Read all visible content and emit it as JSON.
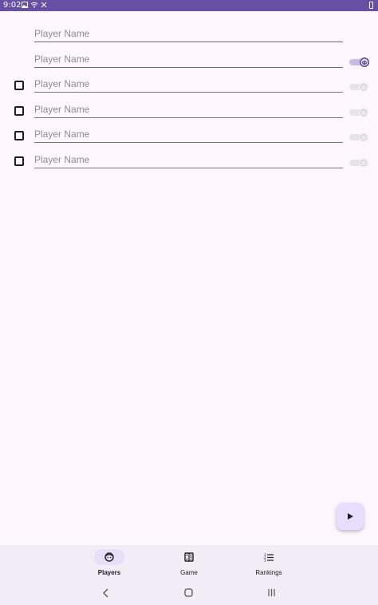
{
  "status_bar": {
    "time": "9:02",
    "icons": [
      "image-icon",
      "wifi-icon",
      "data-icon",
      "battery-icon"
    ],
    "color": "#6750a4"
  },
  "players": {
    "placeholder": "Player Name",
    "rows": [
      {
        "has_checkbox": false,
        "has_switch": false,
        "switch_on": false
      },
      {
        "has_checkbox": false,
        "has_switch": true,
        "switch_on": true
      },
      {
        "has_checkbox": true,
        "has_switch": true,
        "switch_on": false
      },
      {
        "has_checkbox": true,
        "has_switch": true,
        "switch_on": false
      },
      {
        "has_checkbox": true,
        "has_switch": true,
        "switch_on": false
      },
      {
        "has_checkbox": true,
        "has_switch": true,
        "switch_on": false
      }
    ]
  },
  "fab": {
    "icon": "play-icon"
  },
  "bottom_nav": {
    "items": [
      {
        "label": "Players",
        "icon": "face-icon",
        "selected": true
      },
      {
        "label": "Game",
        "icon": "dice-icon",
        "selected": false
      },
      {
        "label": "Rankings",
        "icon": "list-icon",
        "selected": false
      }
    ]
  },
  "system_nav": {
    "icons": [
      "back-icon",
      "home-icon",
      "recents-icon"
    ]
  },
  "colors": {
    "primary": "#6750a4",
    "surface": "#fdf7fd",
    "nav_bg": "#f2ecf6",
    "accent_container": "#e9ddff"
  }
}
